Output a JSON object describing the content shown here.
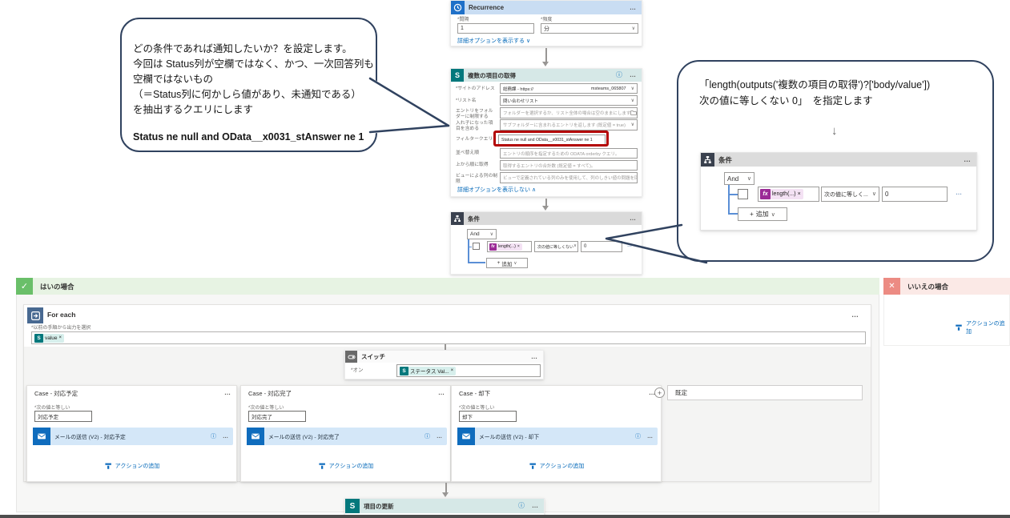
{
  "glyphs": {
    "chevron_down": "∨",
    "chevron_up": "∧",
    "dots": "…",
    "info": "ⓘ",
    "plus": "+",
    "check": "✓",
    "cross": "✕",
    "down_arrow": "↓",
    "remove": "×",
    "sharepoint": "S",
    "fx": "fx"
  },
  "colors": {
    "recurrence_blue": "#1f70c8",
    "sharepoint_teal": "#03787c",
    "condition_dark": "#3a414e",
    "outlook_blue": "#0f6cbd",
    "success_green": "#6abf69",
    "fail_red": "#ec8b83",
    "link_blue": "#0067b8",
    "highlight_red": "#b30505",
    "bubble_border": "#30425f"
  },
  "recurrence": {
    "title": "Recurrence",
    "interval_label": "*間隔",
    "interval_value": "1",
    "frequency_label": "*頻度",
    "frequency_value": "分",
    "options_link": "詳細オプションを表示する"
  },
  "get_items": {
    "title": "複数の項目の取得",
    "site_label": "*サイトのアドレス",
    "site_value_left": "総務課 - https://",
    "site_value_right": "msteams_065807",
    "list_label": "*リスト名",
    "list_value": "問い合わせリスト",
    "folder_label": "エントリをフォルダーに制限する",
    "folder_placeholder": "フォルダーを選択するか、リスト全体の場合は空のままにします",
    "nested_label": "入れ子になった項目を含める",
    "nested_value": "サブフォルダーに含まれるエントリを返します (既定値 = true)",
    "filter_label": "フィルタークエリ",
    "filter_value": "Status ne null and OData__x0031_stAnswer ne 1",
    "orderby_label": "並べ替え順",
    "orderby_placeholder": "エントリの順序を指定するための ODATA orderby クエリ。",
    "top_label": "上から順に取得",
    "top_placeholder": "取得するエントリの合計数 (既定値 = すべて)。",
    "view_label": "ビューによる列の制限",
    "view_placeholder": "ビューで定義されている列のみを使用して、列のしきい値の問題を回避",
    "options_link": "詳細オプションを表示しない"
  },
  "condition": {
    "title": "条件",
    "group_operator": "And",
    "fx_token": "length(...)",
    "operator": "次の値に等しくない",
    "value": "0",
    "add_label": "追加"
  },
  "bubble_left": {
    "lines": [
      "どの条件であれば通知したいか？を設定します。",
      "今回は Status列が空欄ではなく、かつ、一次回答列も",
      "空欄ではないもの",
      "（＝Status列に何かしら値があり、未通知である）",
      "を抽出するクエリにします"
    ],
    "query": "Status ne null and OData__x0031_stAnswer ne 1"
  },
  "bubble_right": {
    "line1": "「length(outputs('複数の項目の取得')?['body/value'])",
    "line2": "次の値に等しくない 0」　を指定します",
    "card": {
      "title": "条件",
      "group_operator": "And",
      "fx_token": "length(...)",
      "operator": "次の値に等しく...",
      "value": "0",
      "add_label": "追加"
    }
  },
  "yes_branch": {
    "title": "はいの場合",
    "for_each": {
      "title": "For each",
      "output_label": "*以前の手順から出力を選択",
      "token": "value"
    },
    "switch": {
      "title": "スイッチ",
      "on_label": "*オン",
      "token": "ステータス Val..."
    },
    "cases": [
      {
        "title": "Case - 対応予定",
        "equals_label": "*次の値と等しい",
        "equals_value": "対応予定",
        "mail_title": "メールの送信 (V2) - 対応予定"
      },
      {
        "title": "Case - 対応完了",
        "equals_label": "*次の値と等しい",
        "equals_value": "対応完了",
        "mail_title": "メールの送信 (V2) - 対応完了"
      },
      {
        "title": "Case - 却下",
        "equals_label": "*次の値と等しい",
        "equals_value": "却下",
        "mail_title": "メールの送信 (V2) - 却下"
      }
    ],
    "default_label": "既定",
    "add_action_label": "アクションの追加",
    "update_item_title": "項目の更新"
  },
  "no_branch": {
    "title": "いいえの場合",
    "add_action_label": "アクションの追加"
  }
}
